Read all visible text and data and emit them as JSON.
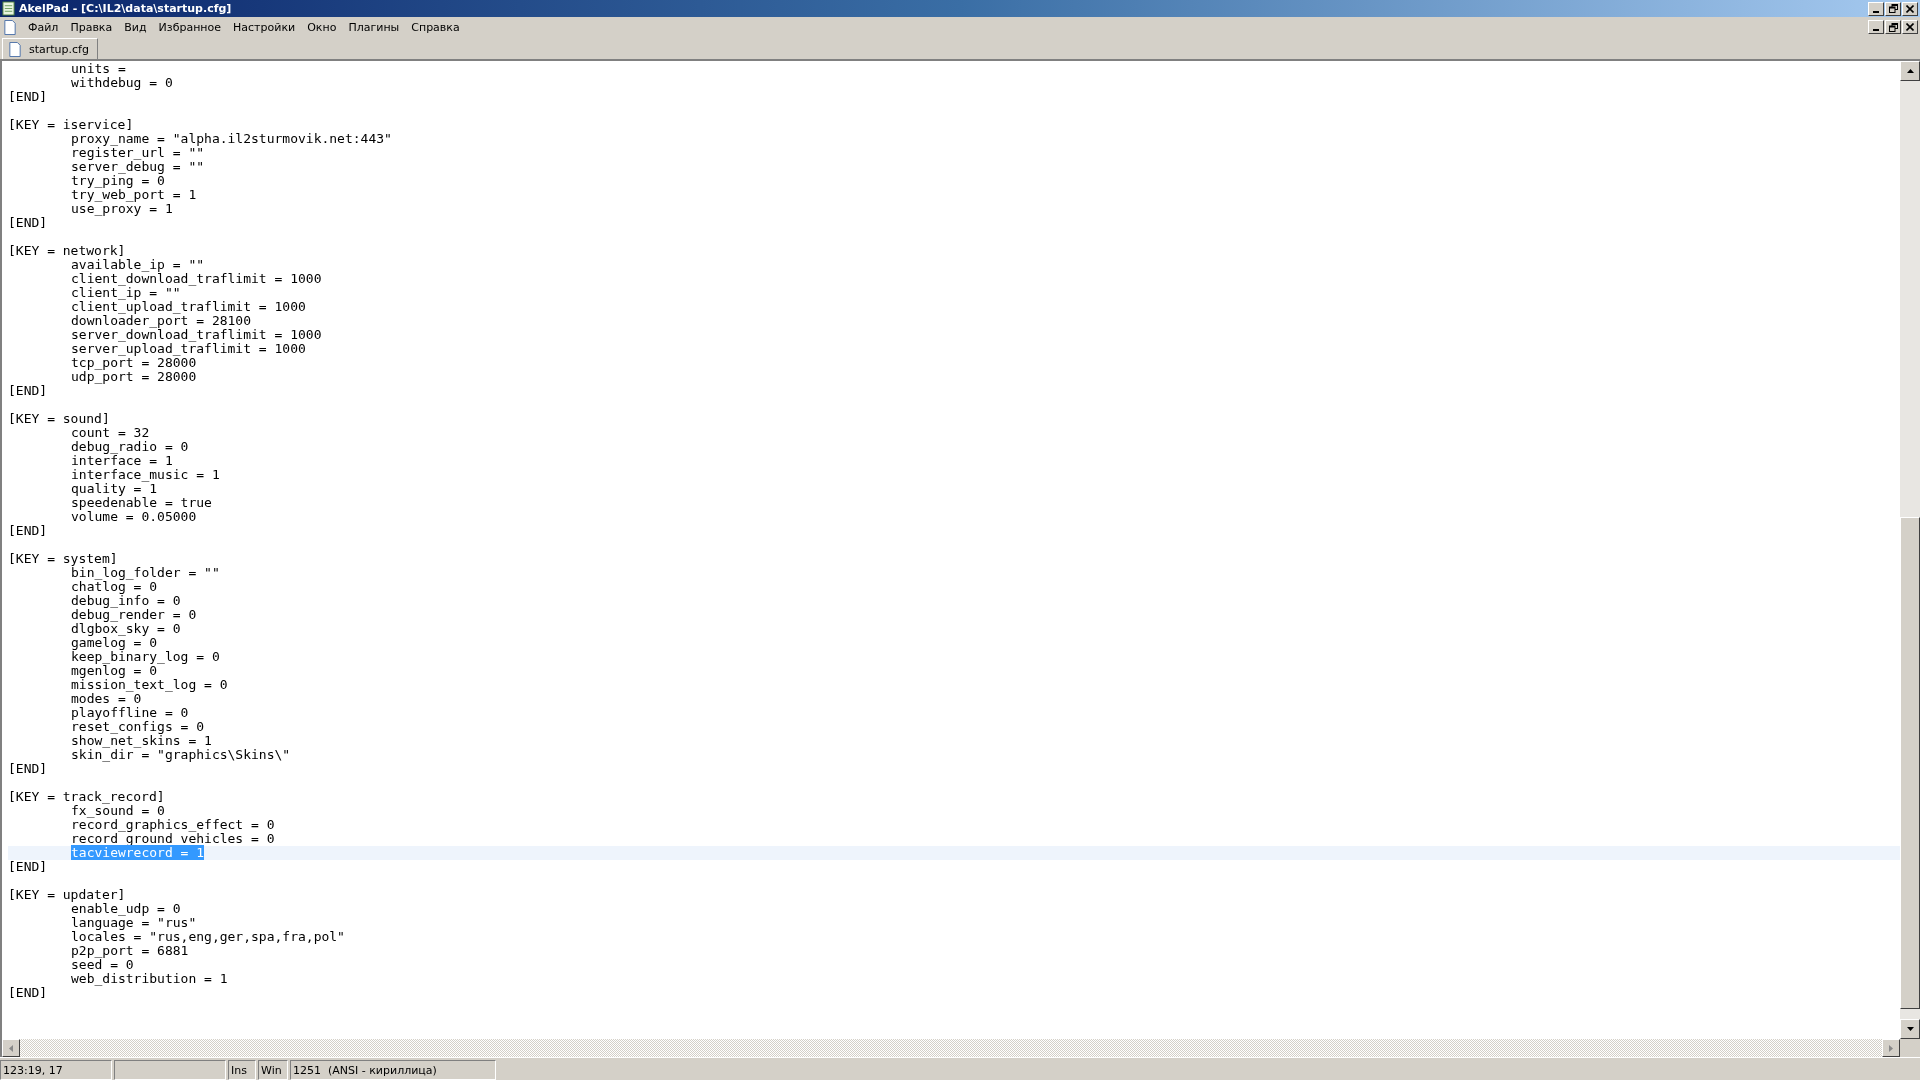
{
  "window": {
    "title": "AkelPad - [C:\\IL2\\data\\startup.cfg]"
  },
  "menu": [
    "Файл",
    "Правка",
    "Вид",
    "Избранное",
    "Настройки",
    "Окно",
    "Плагины",
    "Справка"
  ],
  "tabs": [
    {
      "label": "startup.cfg",
      "selected": true
    }
  ],
  "lines": [
    {
      "kind": "entry",
      "text": "units =",
      "selected": false
    },
    {
      "kind": "entry",
      "text": "withdebug = 0",
      "selected": false
    },
    {
      "kind": "bracket",
      "text": "[END]",
      "selected": false
    },
    {
      "kind": "blank",
      "selected": false
    },
    {
      "kind": "bracket",
      "text": "[KEY = iservice]",
      "selected": false
    },
    {
      "kind": "entry",
      "text": "proxy_name = \"alpha.il2sturmovik.net:443\"",
      "selected": false
    },
    {
      "kind": "entry",
      "text": "register_url = \"\"",
      "selected": false
    },
    {
      "kind": "entry",
      "text": "server_debug = \"\"",
      "selected": false
    },
    {
      "kind": "entry",
      "text": "try_ping = 0",
      "selected": false
    },
    {
      "kind": "entry",
      "text": "try_web_port = 1",
      "selected": false
    },
    {
      "kind": "entry",
      "text": "use_proxy = 1",
      "selected": false
    },
    {
      "kind": "bracket",
      "text": "[END]",
      "selected": false
    },
    {
      "kind": "blank",
      "selected": false
    },
    {
      "kind": "bracket",
      "text": "[KEY = network]",
      "selected": false
    },
    {
      "kind": "entry",
      "text": "available_ip = \"\"",
      "selected": false
    },
    {
      "kind": "entry",
      "text": "client_download_traflimit = 1000",
      "selected": false
    },
    {
      "kind": "entry",
      "text": "client_ip = \"\"",
      "selected": false
    },
    {
      "kind": "entry",
      "text": "client_upload_traflimit = 1000",
      "selected": false
    },
    {
      "kind": "entry",
      "text": "downloader_port = 28100",
      "selected": false
    },
    {
      "kind": "entry",
      "text": "server_download_traflimit = 1000",
      "selected": false
    },
    {
      "kind": "entry",
      "text": "server_upload_traflimit = 1000",
      "selected": false
    },
    {
      "kind": "entry",
      "text": "tcp_port = 28000",
      "selected": false
    },
    {
      "kind": "entry",
      "text": "udp_port = 28000",
      "selected": false
    },
    {
      "kind": "bracket",
      "text": "[END]",
      "selected": false
    },
    {
      "kind": "blank",
      "selected": false
    },
    {
      "kind": "bracket",
      "text": "[KEY = sound]",
      "selected": false
    },
    {
      "kind": "entry",
      "text": "count = 32",
      "selected": false
    },
    {
      "kind": "entry",
      "text": "debug_radio = 0",
      "selected": false
    },
    {
      "kind": "entry",
      "text": "interface = 1",
      "selected": false
    },
    {
      "kind": "entry",
      "text": "interface_music = 1",
      "selected": false
    },
    {
      "kind": "entry",
      "text": "quality = 1",
      "selected": false
    },
    {
      "kind": "entry",
      "text": "speedenable = true",
      "selected": false
    },
    {
      "kind": "entry",
      "text": "volume = 0.05000",
      "selected": false
    },
    {
      "kind": "bracket",
      "text": "[END]",
      "selected": false
    },
    {
      "kind": "blank",
      "selected": false
    },
    {
      "kind": "bracket",
      "text": "[KEY = system]",
      "selected": false
    },
    {
      "kind": "entry",
      "text": "bin_log_folder = \"\"",
      "selected": false
    },
    {
      "kind": "entry",
      "text": "chatlog = 0",
      "selected": false
    },
    {
      "kind": "entry",
      "text": "debug_info = 0",
      "selected": false
    },
    {
      "kind": "entry",
      "text": "debug_render = 0",
      "selected": false
    },
    {
      "kind": "entry",
      "text": "dlgbox_sky = 0",
      "selected": false
    },
    {
      "kind": "entry",
      "text": "gamelog = 0",
      "selected": false
    },
    {
      "kind": "entry",
      "text": "keep_binary_log = 0",
      "selected": false
    },
    {
      "kind": "entry",
      "text": "mgenlog = 0",
      "selected": false
    },
    {
      "kind": "entry",
      "text": "mission_text_log = 0",
      "selected": false
    },
    {
      "kind": "entry",
      "text": "modes = 0",
      "selected": false
    },
    {
      "kind": "entry",
      "text": "playoffline = 0",
      "selected": false
    },
    {
      "kind": "entry",
      "text": "reset_configs = 0",
      "selected": false
    },
    {
      "kind": "entry",
      "text": "show_net_skins = 1",
      "selected": false
    },
    {
      "kind": "entry",
      "text": "skin_dir = \"graphics\\Skins\\\"",
      "selected": false
    },
    {
      "kind": "bracket",
      "text": "[END]",
      "selected": false
    },
    {
      "kind": "blank",
      "selected": false
    },
    {
      "kind": "bracket",
      "text": "[KEY = track_record]",
      "selected": false
    },
    {
      "kind": "entry",
      "text": "fx_sound = 0",
      "selected": false
    },
    {
      "kind": "entry",
      "text": "record_graphics_effect = 0",
      "selected": false
    },
    {
      "kind": "entry",
      "text": "record_ground_vehicles = 0",
      "selected": false
    },
    {
      "kind": "entry",
      "text": "tacviewrecord = 1",
      "selected": true
    },
    {
      "kind": "bracket",
      "text": "[END]",
      "selected": false
    },
    {
      "kind": "blank",
      "selected": false
    },
    {
      "kind": "bracket",
      "text": "[KEY = updater]",
      "selected": false
    },
    {
      "kind": "entry",
      "text": "enable_udp = 0",
      "selected": false
    },
    {
      "kind": "entry",
      "text": "language = \"rus\"",
      "selected": false
    },
    {
      "kind": "entry",
      "text": "locales = \"rus,eng,ger,spa,fra,pol\"",
      "selected": false
    },
    {
      "kind": "entry",
      "text": "p2p_port = 6881",
      "selected": false
    },
    {
      "kind": "entry",
      "text": "seed = 0",
      "selected": false
    },
    {
      "kind": "entry",
      "text": "web_distribution = 1",
      "selected": false
    },
    {
      "kind": "bracket",
      "text": "[END]",
      "selected": false
    }
  ],
  "status_bar": {
    "position": "123:19, 17",
    "insert_mode": "Ins",
    "line_endings": "Win",
    "encoding": "1251  (ANSI - кириллица)"
  }
}
